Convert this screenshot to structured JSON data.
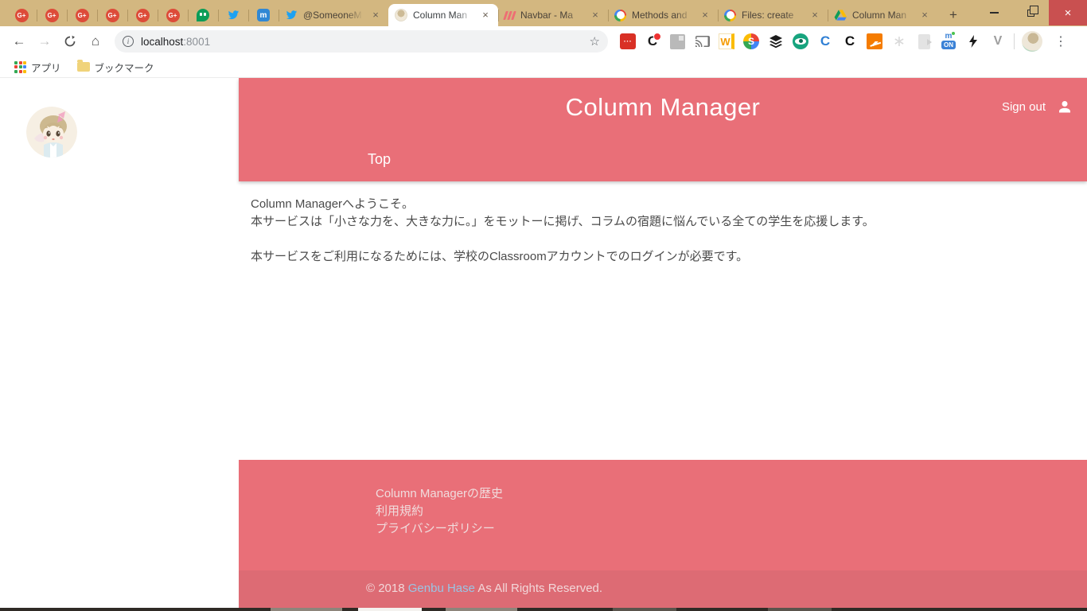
{
  "browser": {
    "titlebar": {
      "pinned_tabs": [
        {
          "icon": "google-plus-icon"
        },
        {
          "icon": "google-plus-icon"
        },
        {
          "icon": "google-plus-icon"
        },
        {
          "icon": "google-plus-icon"
        },
        {
          "icon": "google-plus-icon"
        },
        {
          "icon": "google-plus-icon"
        },
        {
          "icon": "hangouts-icon"
        },
        {
          "icon": "twitter-icon"
        },
        {
          "icon": "mastodon-icon"
        }
      ],
      "tabs": [
        {
          "label": "@SomeoneM",
          "icon": "twitter-icon",
          "active": false
        },
        {
          "label": "Column Man",
          "icon": "avatar-favicon",
          "active": true
        },
        {
          "label": "Navbar - Ma",
          "icon": "materialize-icon",
          "active": false
        },
        {
          "label": "Methods and",
          "icon": "google-developers-icon",
          "active": false
        },
        {
          "label": "Files: create",
          "icon": "google-developers-icon",
          "active": false
        },
        {
          "label": "Column Man",
          "icon": "google-drive-icon",
          "active": false
        }
      ],
      "glyphs": {
        "gplus": "G+",
        "mastodon": "m",
        "close": "×",
        "new_tab": "+",
        "window_close": "×"
      }
    },
    "toolbar": {
      "back_glyph": "←",
      "forward_glyph": "→",
      "home_glyph": "⌂",
      "info_glyph": "i",
      "url_host": "localhost",
      "url_port": ":8001",
      "star_glyph": "☆",
      "menu_glyph": "⋮",
      "extensions": [
        {
          "name": "password-dots-extension-icon",
          "glyph": "···"
        },
        {
          "name": "black-c-badge-extension-icon",
          "glyph": "C"
        },
        {
          "name": "photos-gray-extension-icon",
          "glyph": ""
        },
        {
          "name": "chromecast-extension-icon",
          "glyph": ""
        },
        {
          "name": "orange-w-extension-icon",
          "glyph": "W"
        },
        {
          "name": "multicolor-s-extension-icon",
          "glyph": "S"
        },
        {
          "name": "layers-stack-extension-icon",
          "glyph": ""
        },
        {
          "name": "green-eye-extension-icon",
          "glyph": ""
        },
        {
          "name": "blue-c-extension-icon",
          "glyph": "C"
        },
        {
          "name": "black-c-extension-icon",
          "glyph": "C"
        },
        {
          "name": "analytics-chart-extension-icon",
          "glyph": ""
        },
        {
          "name": "flower-disabled-extension-icon",
          "glyph": "∗"
        },
        {
          "name": "page-disabled-extension-icon",
          "glyph": ""
        },
        {
          "name": "mastodon-on-extension-icon",
          "glyph": "ON",
          "extra": "m"
        },
        {
          "name": "lightning-extension-icon",
          "glyph": ""
        },
        {
          "name": "vimium-v-extension-icon",
          "glyph": "V"
        }
      ]
    },
    "bookmarks_bar": {
      "apps_label": "アプリ",
      "bookmarks_label": "ブックマーク"
    }
  },
  "page": {
    "header": {
      "title": "Column Manager",
      "sign_out_label": "Sign out",
      "nav_items": [
        {
          "label": "Top"
        }
      ]
    },
    "content": {
      "paragraphs": [
        "Column Managerへようこそ。",
        "本サービスは「小さな力を、大きな力に。」をモットーに掲げ、コラムの宿題に悩んでいる全ての学生を応援します。",
        "",
        "本サービスをご利用になるためには、学校のClassroomアカウントでのログインが必要です。"
      ]
    },
    "footer": {
      "links": [
        "Column Managerの歴史",
        "利用規約",
        "プライバシーポリシー"
      ],
      "copyright_prefix": "© 2018 ",
      "copyright_link_text": "Genbu Hase",
      "copyright_suffix": " As All Rights Reserved."
    },
    "colors": {
      "accent": "#e96f78",
      "accent_dark": "#dd6b74",
      "copyright_link": "#9ac4e4",
      "titlebar": "#d3b780"
    }
  }
}
